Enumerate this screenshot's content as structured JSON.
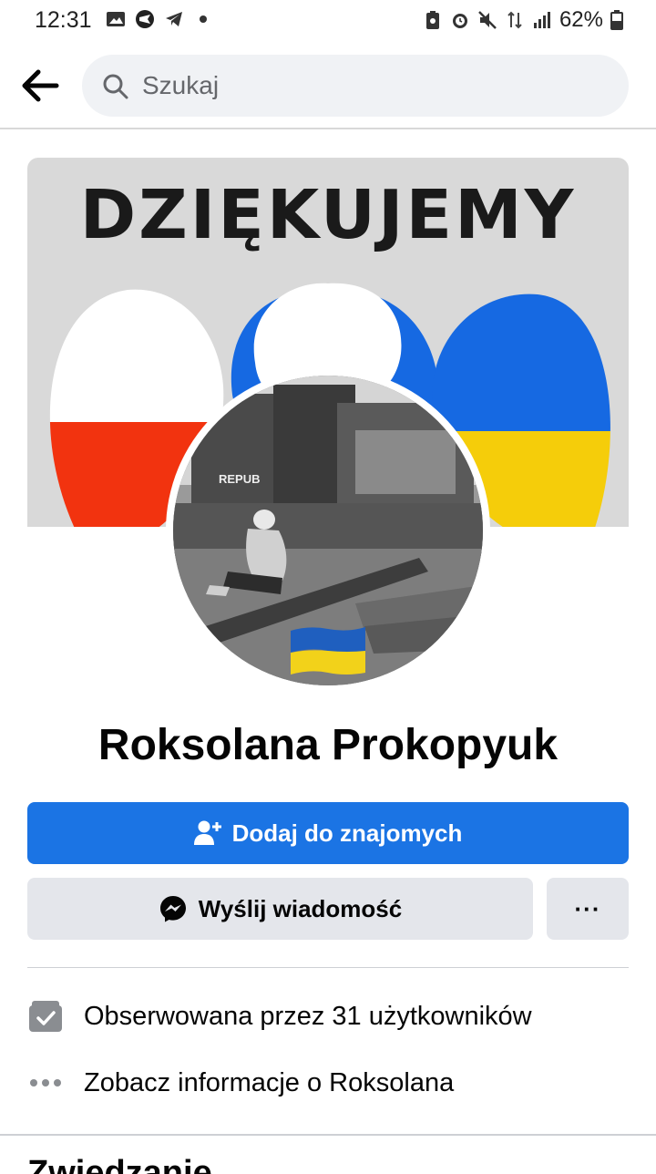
{
  "status_bar": {
    "time": "12:31",
    "battery": "62%"
  },
  "search": {
    "placeholder": "Szukaj"
  },
  "cover": {
    "title": "DZIĘKUJEMY",
    "colors": {
      "poland_white": "#ffffff",
      "poland_red": "#f2330f",
      "ukraine_blue": "#1669e2",
      "ukraine_yellow": "#f5cd0a"
    }
  },
  "avatar": {
    "wall_text": "REPUB",
    "flag_colors": [
      "#1f5fbf",
      "#f2d21a"
    ]
  },
  "profile": {
    "name": "Roksolana Prokopyuk"
  },
  "actions": {
    "add_friend_label": "Dodaj do znajomych",
    "message_label": "Wyślij wiadomość",
    "more_label": "···"
  },
  "info": {
    "followers_text": "Obserwowana przez 31 użytkowników",
    "about_text": "Zobacz informacje o Roksolana"
  },
  "section": {
    "title": "Zwiedzanie"
  },
  "colors": {
    "primary": "#1b74e4",
    "secondary_bg": "#e4e6eb",
    "search_bg": "#f0f2f5"
  }
}
